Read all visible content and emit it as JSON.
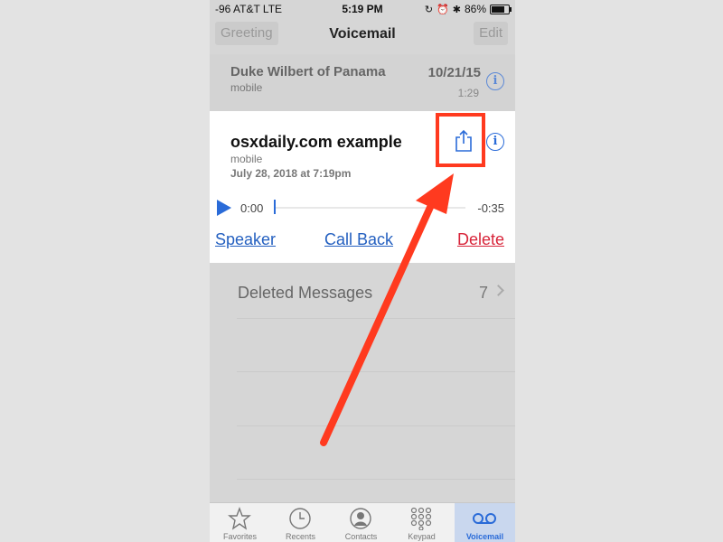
{
  "status_bar": {
    "carrier": "-96 AT&T  LTE",
    "time": "5:19 PM",
    "battery": "86%"
  },
  "nav": {
    "greeting_label": "Greeting",
    "title": "Voicemail",
    "edit_label": "Edit"
  },
  "voicemails": [
    {
      "name": "Duke Wilbert of Panama",
      "type": "mobile",
      "date": "10/21/15",
      "duration": "1:29"
    }
  ],
  "expanded": {
    "name": "osxdaily.com example",
    "type": "mobile",
    "date": "July 28, 2018 at 7:19pm",
    "time_start": "0:00",
    "time_end": "-0:35",
    "progress": 0,
    "speaker_label": "Speaker",
    "callback_label": "Call Back",
    "delete_label": "Delete"
  },
  "deleted": {
    "label": "Deleted Messages",
    "count": "7"
  },
  "tabs": [
    {
      "label": "Favorites",
      "icon": "star-icon"
    },
    {
      "label": "Recents",
      "icon": "clock-icon"
    },
    {
      "label": "Contacts",
      "icon": "person-icon"
    },
    {
      "label": "Keypad",
      "icon": "keypad-icon"
    },
    {
      "label": "Voicemail",
      "icon": "voicemail-icon",
      "selected": true
    }
  ],
  "colors": {
    "accent": "#2a6bd8",
    "delete": "#d8253a",
    "annotation": "#ff3a1f"
  }
}
